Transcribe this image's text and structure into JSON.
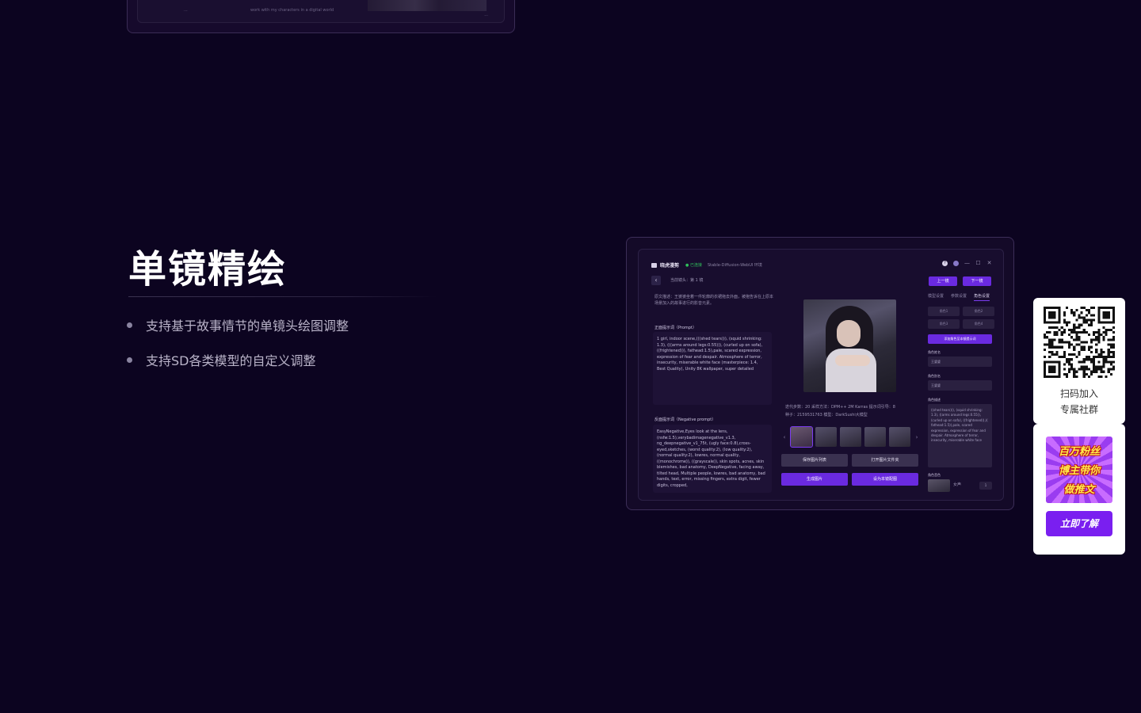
{
  "top_frame": {
    "text_a": "...",
    "text_b": "work with my characters in a digital world",
    "text_c": "..."
  },
  "hero": {
    "title": "单镜精绘",
    "bullets": [
      "支持基于故事情节的单镜头绘图调整",
      "支持SD各类模型的自定义调整"
    ]
  },
  "app": {
    "name": "晓虎漫剪",
    "status": "● 已连接",
    "env": "Stable-Diffusion-WebUI 环境",
    "window_controls": [
      "?",
      "",
      "—",
      "☐",
      "✕"
    ],
    "shot_info": "当前镜头：第 1 镜",
    "prev_label": "上一镜",
    "next_label": "下一镜",
    "description": "原文描述：王婆婆坐着一件轮廓的衣裙拖去外面，被抱告诉在上原本场景加入的故事进行的影音元素。",
    "positive_label": "正面提示词（Prompt）",
    "positive_prompt": "1 girl, indoor scene,(((shed tears))), (squid shrinking: 1.3), (((arms around legs:0.55))), (curled up on sofa), ((frightened))), fathead:1.5),pale, scared expression, expression of fear and despair. Atmosphere of terror, insecurity, miserable white face (masterpiece: 1.4, Best Quality), Unity 8K wallpaper, super detailed",
    "negative_label": "反面提示词（Negative prompt）",
    "negative_prompt": "EasyNegative,Eyes look at the lens, (nsfw:1.5),verybadimagenegative_v1.3, ng_deepnegative_v1_75t, (ugly face:0.8),cross-eyed,sketches, (worst quality:2), (low quality:2), (normal quality:2), lowres, normal quality, ((monochrome)), ((grayscale)), skin spots, acnes, skin blemishes, bad anatomy, DeepNegative, facing away, tilted head, Multiple people, lowres, bad anatomy, bad hands, text, error, missing fingers, extra digit, fewer digits, cropped,",
    "meta_line1": "迭代步数：20   采样方法：DPM++ 2M Karras   提示词引导：8",
    "meta_line2": "种子：2159531763   模型：DarkSushi大模型",
    "thumb_prev": "‹",
    "thumb_next": "›",
    "actions": [
      "保存图片列表",
      "打开图片文件夹",
      "生成图片",
      "设为本镜配图"
    ],
    "tabs": [
      "模型设置",
      "参数设置",
      "角色设置"
    ],
    "characters": [
      "角色1",
      "角色2",
      "角色3",
      "角色4"
    ],
    "add_character": "添加角色至本镜提示词",
    "field_name_label": "角色姓名",
    "field_name_value": "王婆婆",
    "field_alias_label": "角色别名",
    "field_alias_value": "王婆婆",
    "field_desc_label": "角色描述",
    "field_desc_value": "((shed tears))), (squid shrinking: 1.3), ((arms around legs:0.55)), (curled up on sofa), ((frightened)),(( fathead:1.5)),pale, scared expression, expression of fear and despair. Atmosphere of terror, insecurity, miserable white face",
    "voice_label": "角色音色",
    "voice_name": "女声",
    "voice_step": "1"
  },
  "qr_card": {
    "line1": "扫码加入",
    "line2": "专属社群"
  },
  "promo": {
    "line1": "百万粉丝",
    "line2": "博主带你",
    "line3": "做推文",
    "button": "立即了解"
  }
}
